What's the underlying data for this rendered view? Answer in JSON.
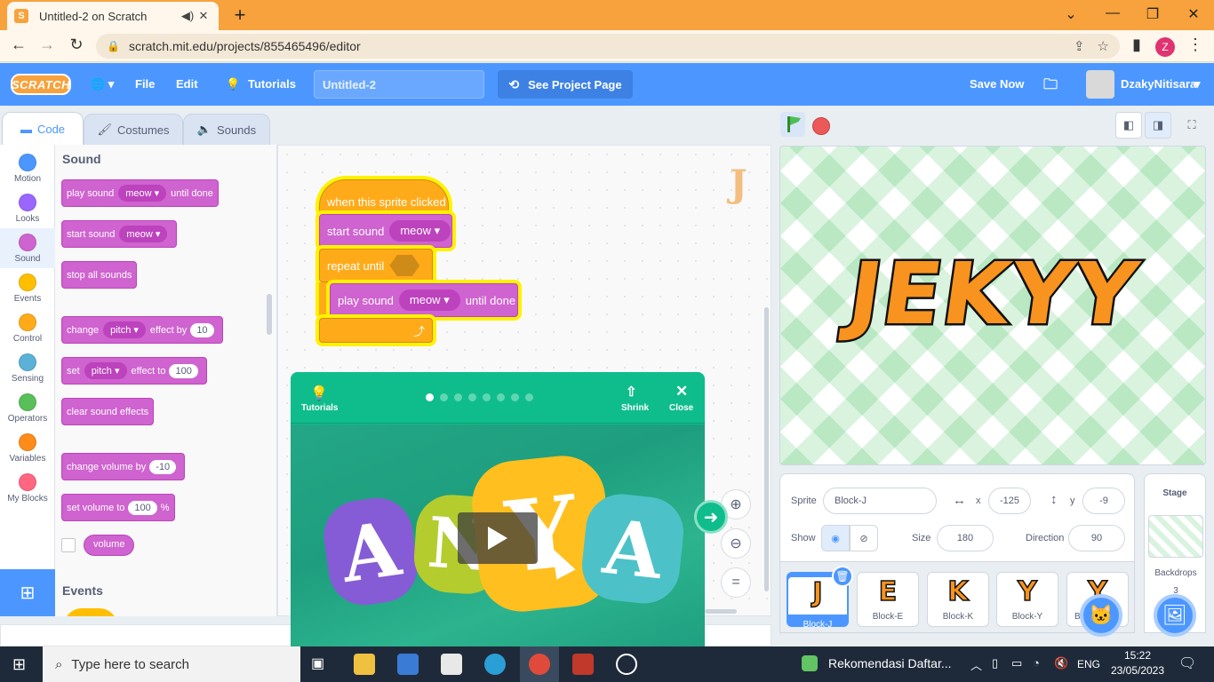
{
  "browser": {
    "tab_title": "Untitled-2 on Scratch",
    "favicon": "S",
    "url": "scratch.mit.edu/projects/855465496/editor",
    "profile_initial": "Z",
    "colors": {
      "tabbar": "#f7a23c",
      "toolbar": "#fff7ec"
    }
  },
  "menubar": {
    "logo": "SCRATCH",
    "file": "File",
    "edit": "Edit",
    "tutorials": "Tutorials",
    "project_title": "Untitled-2",
    "see_project": "See Project Page",
    "save_now": "Save Now",
    "username": "DzakyNitisara",
    "accent": "#4c97ff"
  },
  "editor_tabs": [
    "Code",
    "Costumes",
    "Sounds"
  ],
  "categories": [
    {
      "label": "Motion",
      "color": "#4c97ff"
    },
    {
      "label": "Looks",
      "color": "#9966ff"
    },
    {
      "label": "Sound",
      "color": "#cf63cf"
    },
    {
      "label": "Events",
      "color": "#ffbf00"
    },
    {
      "label": "Control",
      "color": "#ffab19"
    },
    {
      "label": "Sensing",
      "color": "#5cb1d6"
    },
    {
      "label": "Operators",
      "color": "#59c059"
    },
    {
      "label": "Variables",
      "color": "#ff8c1a"
    },
    {
      "label": "My Blocks",
      "color": "#ff6680"
    }
  ],
  "palette": {
    "heading": "Sound",
    "events_heading": "Events",
    "play_sound": "play sound",
    "until_done": "until done",
    "start_sound": "start sound",
    "meow": "meow",
    "stop_all": "stop all sounds",
    "change": "change",
    "pitch": "pitch",
    "effect_by": "effect by",
    "effect_by_value": "10",
    "set": "set",
    "effect_to": "effect to",
    "effect_to_value": "100",
    "clear_effects": "clear sound effects",
    "change_volume": "change volume by",
    "change_volume_value": "-10",
    "set_volume": "set volume to",
    "set_volume_value": "100",
    "percent": "%",
    "volume": "volume"
  },
  "script": {
    "hat": "when this sprite clicked",
    "start_sound": "start sound",
    "meow": "meow",
    "repeat_until": "repeat until",
    "play_sound": "play sound",
    "until_done": "until done",
    "loop_arrow": "⤴"
  },
  "tutorial": {
    "label": "Tutorials",
    "shrink": "Shrink",
    "close": "Close",
    "dots_total": 8,
    "dots_active": 1,
    "letters": [
      "A",
      "N",
      "Y",
      "A"
    ]
  },
  "stage": {
    "text": "JEKYY",
    "sprite_label": "Sprite",
    "sprite_name": "Block-J",
    "x_label": "x",
    "x_value": "-125",
    "y_label": "y",
    "y_value": "-9",
    "show_label": "Show",
    "size_label": "Size",
    "size_value": "180",
    "direction_label": "Direction",
    "direction_value": "90",
    "stage_label": "Stage",
    "backdrops_label": "Backdrops",
    "backdrops_count": "3"
  },
  "sprites": [
    {
      "name": "Block-J",
      "glyph": "J"
    },
    {
      "name": "Block-E",
      "glyph": "E"
    },
    {
      "name": "Block-K",
      "glyph": "K"
    },
    {
      "name": "Block-Y",
      "glyph": "Y"
    },
    {
      "name": "B",
      "glyph": "Y"
    }
  ],
  "taskbar": {
    "search_placeholder": "Type here to search",
    "notification": "Rekomendasi Daftar...",
    "lang": "ENG",
    "time": "15:22",
    "date": "23/05/2023"
  }
}
